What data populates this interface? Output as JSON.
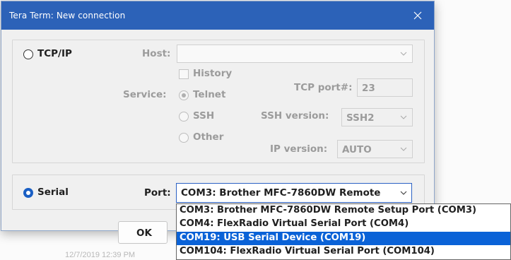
{
  "background": {
    "timestamp_partial": "12/7/2019 12:39 PM"
  },
  "dialog": {
    "title": "Tera Term: New connection",
    "close_glyph": "✕"
  },
  "tcpip": {
    "label": "TCP/IP",
    "selected": false,
    "host_label": "Host:",
    "host_value": "",
    "history_label": "History",
    "history_checked": false,
    "service_label": "Service:",
    "services": [
      {
        "label": "Telnet",
        "selected": true
      },
      {
        "label": "SSH",
        "selected": false
      },
      {
        "label": "Other",
        "selected": false
      }
    ],
    "tcp_port_label": "TCP port#:",
    "tcp_port_value": "23",
    "ssh_version_label": "SSH version:",
    "ssh_version_value": "SSH2",
    "ip_version_label": "IP version:",
    "ip_version_value": "AUTO"
  },
  "serial": {
    "label": "Serial",
    "selected": true,
    "port_label": "Port:",
    "port_value": "COM3: Brother MFC-7860DW Remote",
    "port_options": [
      "COM3: Brother MFC-7860DW Remote Setup Port (COM3)",
      "COM4: FlexRadio Virtual Serial Port (COM4)",
      "COM19: USB Serial Device (COM19)",
      "COM104: FlexRadio Virtual Serial Port (COM104)"
    ],
    "highlighted_option_index": 2
  },
  "buttons": {
    "ok_label": "OK"
  },
  "colors": {
    "titlebar": "#2c62b8",
    "accent": "#1a5fc4",
    "selection": "#0a62d7",
    "disabled_text": "#9b9b9b"
  }
}
